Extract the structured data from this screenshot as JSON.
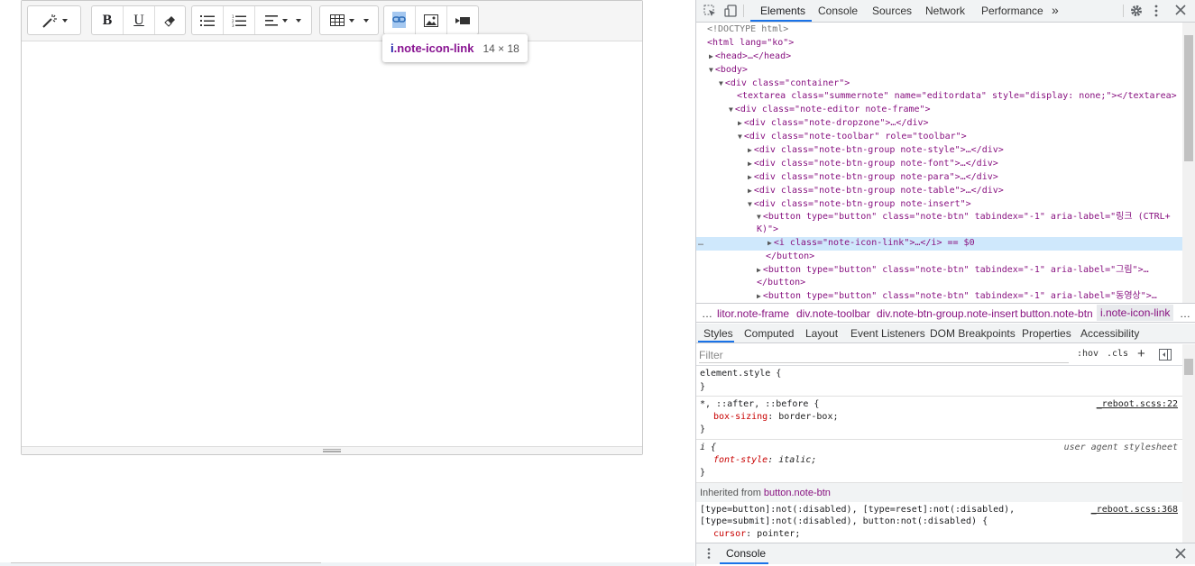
{
  "editor": {
    "toolbar": {
      "magic_icon": "magic-wand-icon",
      "bold": "B",
      "underline": "U",
      "eraser_icon": "eraser-icon",
      "ul_icon": "unordered-list-icon",
      "ol_icon": "ordered-list-icon",
      "align_icon": "align-left-icon",
      "table_icon": "table-icon",
      "link_icon": "link-icon",
      "picture_icon": "picture-icon",
      "video_icon": "video-icon"
    },
    "tooltip": {
      "tag": "i",
      "cls": ".note-icon-link",
      "size": "14 × 18"
    }
  },
  "devtools": {
    "tabs": [
      "Elements",
      "Console",
      "Sources",
      "Network",
      "Performance"
    ],
    "active_tab": "Elements",
    "more": "»",
    "dom": [
      {
        "text": "<!DOCTYPE html>"
      },
      {
        "text": "<html lang=\"ko\">"
      },
      {
        "text": "<head>…</head>"
      },
      {
        "text": "<body>"
      },
      {
        "text": "<div class=\"container\">"
      },
      {
        "text": "<textarea class=\"summernote\" name=\"editordata\" style=\"display: none;\"></textarea>"
      },
      {
        "text": "<div class=\"note-editor note-frame\">"
      },
      {
        "text": "<div class=\"note-dropzone\">…</div>"
      },
      {
        "text": "<div class=\"note-toolbar\" role=\"toolbar\">"
      },
      {
        "text": "<div class=\"note-btn-group note-style\">…</div>"
      },
      {
        "text": "<div class=\"note-btn-group note-font\">…</div>"
      },
      {
        "text": "<div class=\"note-btn-group note-para\">…</div>"
      },
      {
        "text": "<div class=\"note-btn-group note-table\">…</div>"
      },
      {
        "text": "<div class=\"note-btn-group note-insert\">"
      },
      {
        "text": "<button type=\"button\" class=\"note-btn\" tabindex=\"-1\" aria-label=\"링크 (CTRL+"
      },
      {
        "text": "K)\">"
      },
      {
        "text": "<i class=\"note-icon-link\">…</i> == $0"
      },
      {
        "text": "</button>"
      },
      {
        "text": "<button type=\"button\" class=\"note-btn\" tabindex=\"-1\" aria-label=\"그림\">…"
      },
      {
        "text": "</button>"
      },
      {
        "text": "<button type=\"button\" class=\"note-btn\" tabindex=\"-1\" aria-label=\"동영상\">…"
      }
    ],
    "ellipsis": "…",
    "breadcrumbs": [
      "…",
      "litor.note-frame",
      "div.note-toolbar",
      "div.note-btn-group.note-insert",
      "button.note-btn",
      "i.note-icon-link",
      "…"
    ],
    "subtabs": [
      "Styles",
      "Computed",
      "Layout",
      "Event Listeners",
      "DOM Breakpoints",
      "Properties",
      "Accessibility"
    ],
    "filter_placeholder": "Filter",
    "hov": ":hov",
    "cls": ".cls",
    "plus": "+",
    "styles": {
      "element_style": "element.style {",
      "close": "}",
      "rule1_selector": "*, ::after, ::before {",
      "rule1_source": "_reboot.scss:22",
      "rule1_prop": "box-sizing",
      "rule1_val": "border-box;",
      "rule2_selector": "i {",
      "rule2_source": "user agent stylesheet",
      "rule2_prop": "font-style",
      "rule2_val": "italic;",
      "inherited_label": "Inherited from ",
      "inherited_from": "button.note-btn",
      "rule3_selector_1": "[type=button]:not(:disabled), [type=reset]:not(:disabled),",
      "rule3_selector_2": "[type=submit]:not(:disabled), button:not(:disabled) {",
      "rule3_source": "_reboot.scss:368",
      "rule3_prop": "cursor",
      "rule3_val": "pointer;"
    },
    "drawer_tab": "Console"
  }
}
